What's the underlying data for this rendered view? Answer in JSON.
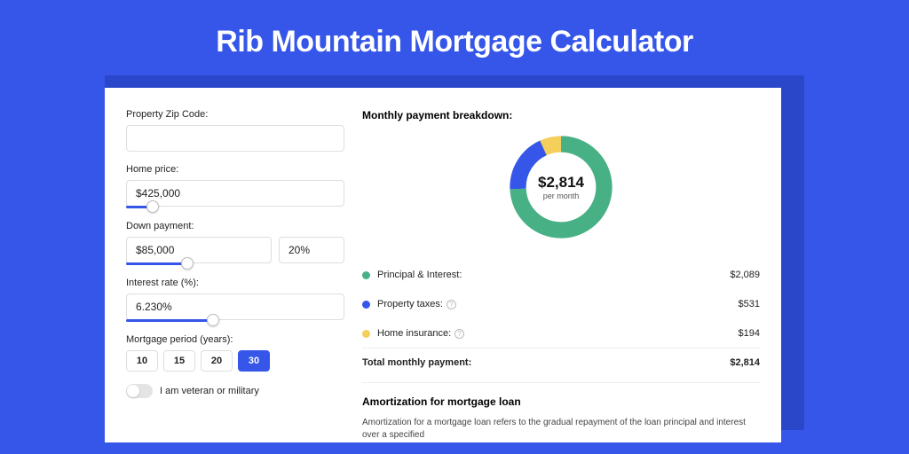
{
  "title": "Rib Mountain Mortgage Calculator",
  "colors": {
    "principal": "#48b085",
    "taxes": "#3556e8",
    "insurance": "#f4cf5b"
  },
  "form": {
    "zip_label": "Property Zip Code:",
    "zip_value": "",
    "home_label": "Home price:",
    "home_value": "$425,000",
    "down_label": "Down payment:",
    "down_value": "$85,000",
    "down_pct": "20%",
    "rate_label": "Interest rate (%):",
    "rate_value": "6.230%",
    "period_label": "Mortgage period (years):",
    "periods": {
      "p10": "10",
      "p15": "15",
      "p20": "20",
      "p30": "30"
    },
    "veteran_label": "I am veteran or military"
  },
  "breakdown": {
    "title": "Monthly payment breakdown:",
    "center_amount": "$2,814",
    "center_sub": "per month",
    "items": {
      "principal": {
        "label": "Principal & Interest:",
        "value": "$2,089"
      },
      "taxes": {
        "label": "Property taxes:",
        "value": "$531"
      },
      "insurance": {
        "label": "Home insurance:",
        "value": "$194"
      }
    },
    "total_label": "Total monthly payment:",
    "total_value": "$2,814"
  },
  "amort": {
    "title": "Amortization for mortgage loan",
    "body": "Amortization for a mortgage loan refers to the gradual repayment of the loan principal and interest over a specified"
  },
  "chart_data": {
    "type": "pie",
    "title": "Monthly payment breakdown",
    "series": [
      {
        "name": "Principal & Interest",
        "value": 2089,
        "color": "#48b085"
      },
      {
        "name": "Property taxes",
        "value": 531,
        "color": "#3556e8"
      },
      {
        "name": "Home insurance",
        "value": 194,
        "color": "#f4cf5b"
      }
    ],
    "total": 2814,
    "unit": "USD per month"
  }
}
